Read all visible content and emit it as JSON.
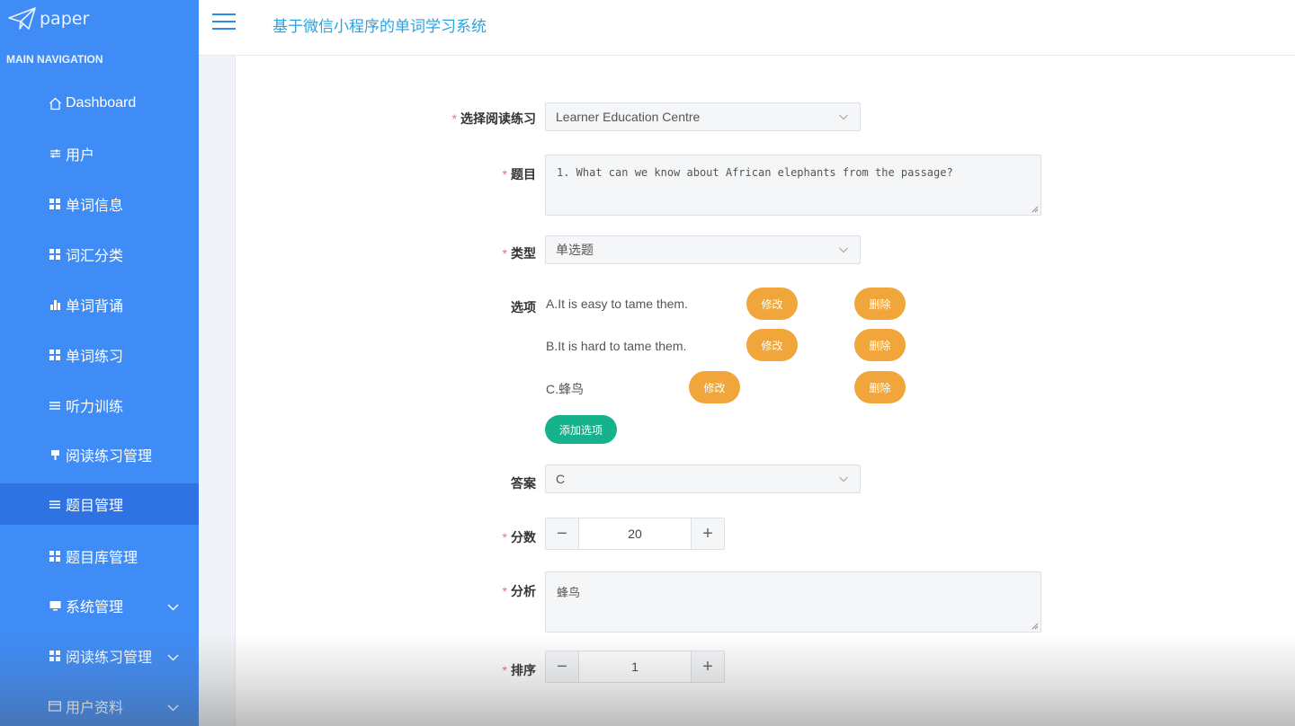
{
  "brand": {
    "name": "paper"
  },
  "sidebar": {
    "section_title": "MAIN NAVIGATION",
    "items": [
      {
        "label": "Dashboard",
        "icon": "home-icon"
      },
      {
        "label": "用户",
        "icon": "sliders-icon"
      },
      {
        "label": "单词信息",
        "icon": "grid-icon"
      },
      {
        "label": "词汇分类",
        "icon": "grid-icon"
      },
      {
        "label": "单词背诵",
        "icon": "bar-chart-icon"
      },
      {
        "label": "单词练习",
        "icon": "grid-icon"
      },
      {
        "label": "听力训练",
        "icon": "list-icon"
      },
      {
        "label": "阅读练习管理",
        "icon": "pin-icon"
      },
      {
        "label": "题目管理",
        "icon": "list-icon",
        "active": true
      },
      {
        "label": "题目库管理",
        "icon": "grid-icon"
      },
      {
        "label": "系统管理",
        "icon": "monitor-icon",
        "expandable": true
      },
      {
        "label": "阅读练习管理",
        "icon": "grid-icon",
        "expandable": true
      },
      {
        "label": "用户资料",
        "icon": "card-icon",
        "expandable": true
      }
    ]
  },
  "header": {
    "title": "基于微信小程序的单词学习系统"
  },
  "form": {
    "reading": {
      "label": "选择阅读练习",
      "value": "Learner Education Centre"
    },
    "question": {
      "label": "题目",
      "value": "1. What can we know about African elephants from the passage?"
    },
    "type": {
      "label": "类型",
      "value": "单选题"
    },
    "options": {
      "label": "选项",
      "items": [
        {
          "text": "A.It is easy to tame them.",
          "edit": "修改",
          "delete": "删除"
        },
        {
          "text": "B.It is hard to tame them.",
          "edit": "修改",
          "delete": "删除"
        },
        {
          "text": "C.蜂鸟",
          "edit": "修改",
          "delete": "删除"
        }
      ],
      "add_label": "添加选项"
    },
    "answer": {
      "label": "答案",
      "value": "C"
    },
    "score": {
      "label": "分数",
      "value": "20"
    },
    "analysis": {
      "label": "分析",
      "value": "蜂鸟"
    },
    "order": {
      "label": "排序",
      "value": "1"
    }
  },
  "colors": {
    "sidebar": "#3f8cf7",
    "active": "#2f72e3",
    "title": "#2aa3e0",
    "orange": "#f0a63a",
    "green": "#16b28c",
    "required": "#f56c6c"
  }
}
